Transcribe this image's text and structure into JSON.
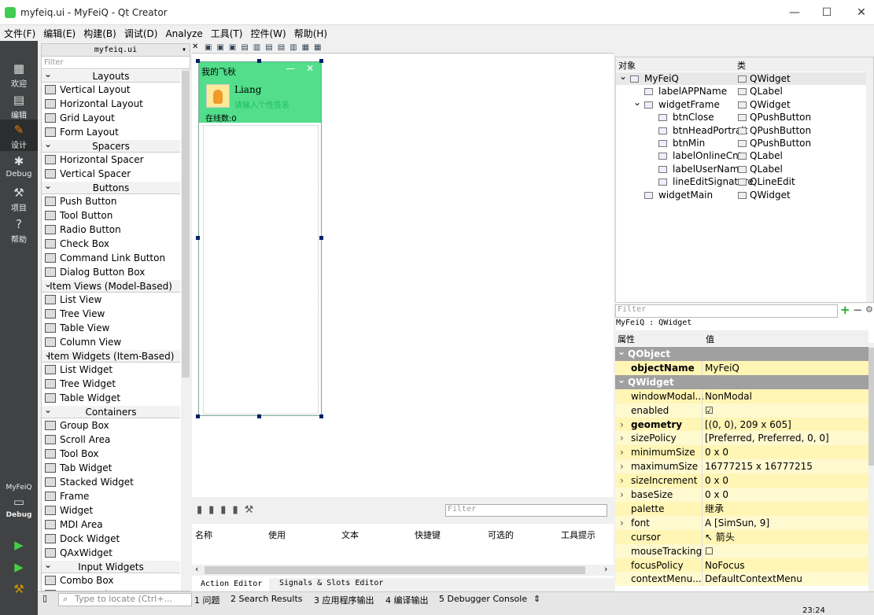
{
  "window": {
    "title": "myfeiq.ui - MyFeiQ - Qt Creator",
    "time": "23:24"
  },
  "menu": [
    "文件(F)",
    "编辑(E)",
    "构建(B)",
    "调试(D)",
    "Analyze",
    "工具(T)",
    "控件(W)",
    "帮助(H)"
  ],
  "modes": [
    "欢迎",
    "编辑",
    "设计",
    "Debug",
    "项目",
    "帮助"
  ],
  "kit": {
    "project": "MyFeiQ",
    "mode": "Debug"
  },
  "widgetbox": {
    "file": "myfeiq.ui",
    "filter": "Filter",
    "rows": [
      {
        "t": "cat",
        "label": "Layouts"
      },
      {
        "t": "item",
        "label": "Vertical Layout"
      },
      {
        "t": "item",
        "label": "Horizontal Layout"
      },
      {
        "t": "item",
        "label": "Grid Layout"
      },
      {
        "t": "item",
        "label": "Form Layout"
      },
      {
        "t": "cat",
        "label": "Spacers"
      },
      {
        "t": "item",
        "label": "Horizontal Spacer"
      },
      {
        "t": "item",
        "label": "Vertical Spacer"
      },
      {
        "t": "cat",
        "label": "Buttons"
      },
      {
        "t": "item",
        "label": "Push Button"
      },
      {
        "t": "item",
        "label": "Tool Button"
      },
      {
        "t": "item",
        "label": "Radio Button"
      },
      {
        "t": "item",
        "label": "Check Box"
      },
      {
        "t": "item",
        "label": "Command Link Button"
      },
      {
        "t": "item",
        "label": "Dialog Button Box"
      },
      {
        "t": "cat",
        "label": "Item Views (Model-Based)"
      },
      {
        "t": "item",
        "label": "List View"
      },
      {
        "t": "item",
        "label": "Tree View"
      },
      {
        "t": "item",
        "label": "Table View"
      },
      {
        "t": "item",
        "label": "Column View"
      },
      {
        "t": "cat",
        "label": "Item Widgets (Item-Based)"
      },
      {
        "t": "item",
        "label": "List Widget"
      },
      {
        "t": "item",
        "label": "Tree Widget"
      },
      {
        "t": "item",
        "label": "Table Widget"
      },
      {
        "t": "cat",
        "label": "Containers"
      },
      {
        "t": "item",
        "label": "Group Box"
      },
      {
        "t": "item",
        "label": "Scroll Area"
      },
      {
        "t": "item",
        "label": "Tool Box"
      },
      {
        "t": "item",
        "label": "Tab Widget"
      },
      {
        "t": "item",
        "label": "Stacked Widget"
      },
      {
        "t": "item",
        "label": "Frame"
      },
      {
        "t": "item",
        "label": "Widget"
      },
      {
        "t": "item",
        "label": "MDI Area"
      },
      {
        "t": "item",
        "label": "Dock Widget"
      },
      {
        "t": "item",
        "label": "QAxWidget"
      },
      {
        "t": "cat",
        "label": "Input Widgets"
      },
      {
        "t": "item",
        "label": "Combo Box"
      },
      {
        "t": "item",
        "label": "Font Combo Box"
      }
    ]
  },
  "form": {
    "title": "我的飞秋",
    "min": "—",
    "close": "✕",
    "username": "Liang",
    "signature": "请输入个性签名",
    "online": "在线数:0"
  },
  "action_editor": {
    "filter": "Filter",
    "columns": [
      "名称",
      "使用",
      "文本",
      "快捷键",
      "可选的",
      "工具提示"
    ],
    "tabs": [
      "Action Editor",
      "Signals & Slots Editor"
    ]
  },
  "status": {
    "locate": "Type to locate (Ctrl+...",
    "items": [
      "1 问题",
      "2 Search Results",
      "3 应用程序输出",
      "4 编译输出",
      "5 Debugger Console"
    ]
  },
  "object_inspector": {
    "col_object": "对象",
    "col_class": "类",
    "rows": [
      {
        "name": "MyFeiQ",
        "cls": "QWidget",
        "depth": 0,
        "exp": "⌄"
      },
      {
        "name": "labelAPPName",
        "cls": "QLabel",
        "depth": 1,
        "exp": ""
      },
      {
        "name": "widgetFrame",
        "cls": "QWidget",
        "depth": 1,
        "exp": "⌄"
      },
      {
        "name": "btnClose",
        "cls": "QPushButton",
        "depth": 2,
        "exp": ""
      },
      {
        "name": "btnHeadPortrait",
        "cls": "QPushButton",
        "depth": 2,
        "exp": ""
      },
      {
        "name": "btnMin",
        "cls": "QPushButton",
        "depth": 2,
        "exp": ""
      },
      {
        "name": "labelOnlineCnt",
        "cls": "QLabel",
        "depth": 2,
        "exp": ""
      },
      {
        "name": "labelUserName",
        "cls": "QLabel",
        "depth": 2,
        "exp": ""
      },
      {
        "name": "lineEditSignature",
        "cls": "QLineEdit",
        "depth": 2,
        "exp": ""
      },
      {
        "name": "widgetMain",
        "cls": "QWidget",
        "depth": 1,
        "exp": ""
      }
    ]
  },
  "property_editor": {
    "filter": "Filter",
    "context": "MyFeiQ : QWidget",
    "col_prop": "属性",
    "col_value": "值",
    "rows": [
      {
        "t": "group",
        "name": "QObject"
      },
      {
        "t": "prop",
        "name": "objectName",
        "value": "MyFeiQ",
        "bold": true
      },
      {
        "t": "group",
        "name": "QWidget"
      },
      {
        "t": "prop",
        "name": "windowModal...",
        "value": "NonModal"
      },
      {
        "t": "prop",
        "name": "enabled",
        "value": "☑"
      },
      {
        "t": "prop",
        "name": "geometry",
        "value": "[(0, 0), 209 x 605]",
        "bold": true,
        "exp": true
      },
      {
        "t": "prop",
        "name": "sizePolicy",
        "value": "[Preferred, Preferred, 0, 0]",
        "exp": true
      },
      {
        "t": "prop",
        "name": "minimumSize",
        "value": "0 x 0",
        "exp": true
      },
      {
        "t": "prop",
        "name": "maximumSize",
        "value": "16777215 x 16777215",
        "exp": true
      },
      {
        "t": "prop",
        "name": "sizeIncrement",
        "value": "0 x 0",
        "exp": true
      },
      {
        "t": "prop",
        "name": "baseSize",
        "value": "0 x 0",
        "exp": true
      },
      {
        "t": "prop",
        "name": "palette",
        "value": "继承"
      },
      {
        "t": "prop",
        "name": "font",
        "value": "A  [SimSun, 9]",
        "exp": true
      },
      {
        "t": "prop",
        "name": "cursor",
        "value": "↖  箭头"
      },
      {
        "t": "prop",
        "name": "mouseTracking",
        "value": "☐"
      },
      {
        "t": "prop",
        "name": "focusPolicy",
        "value": "NoFocus"
      },
      {
        "t": "prop",
        "name": "contextMenu...",
        "value": "DefaultContextMenu"
      }
    ]
  }
}
